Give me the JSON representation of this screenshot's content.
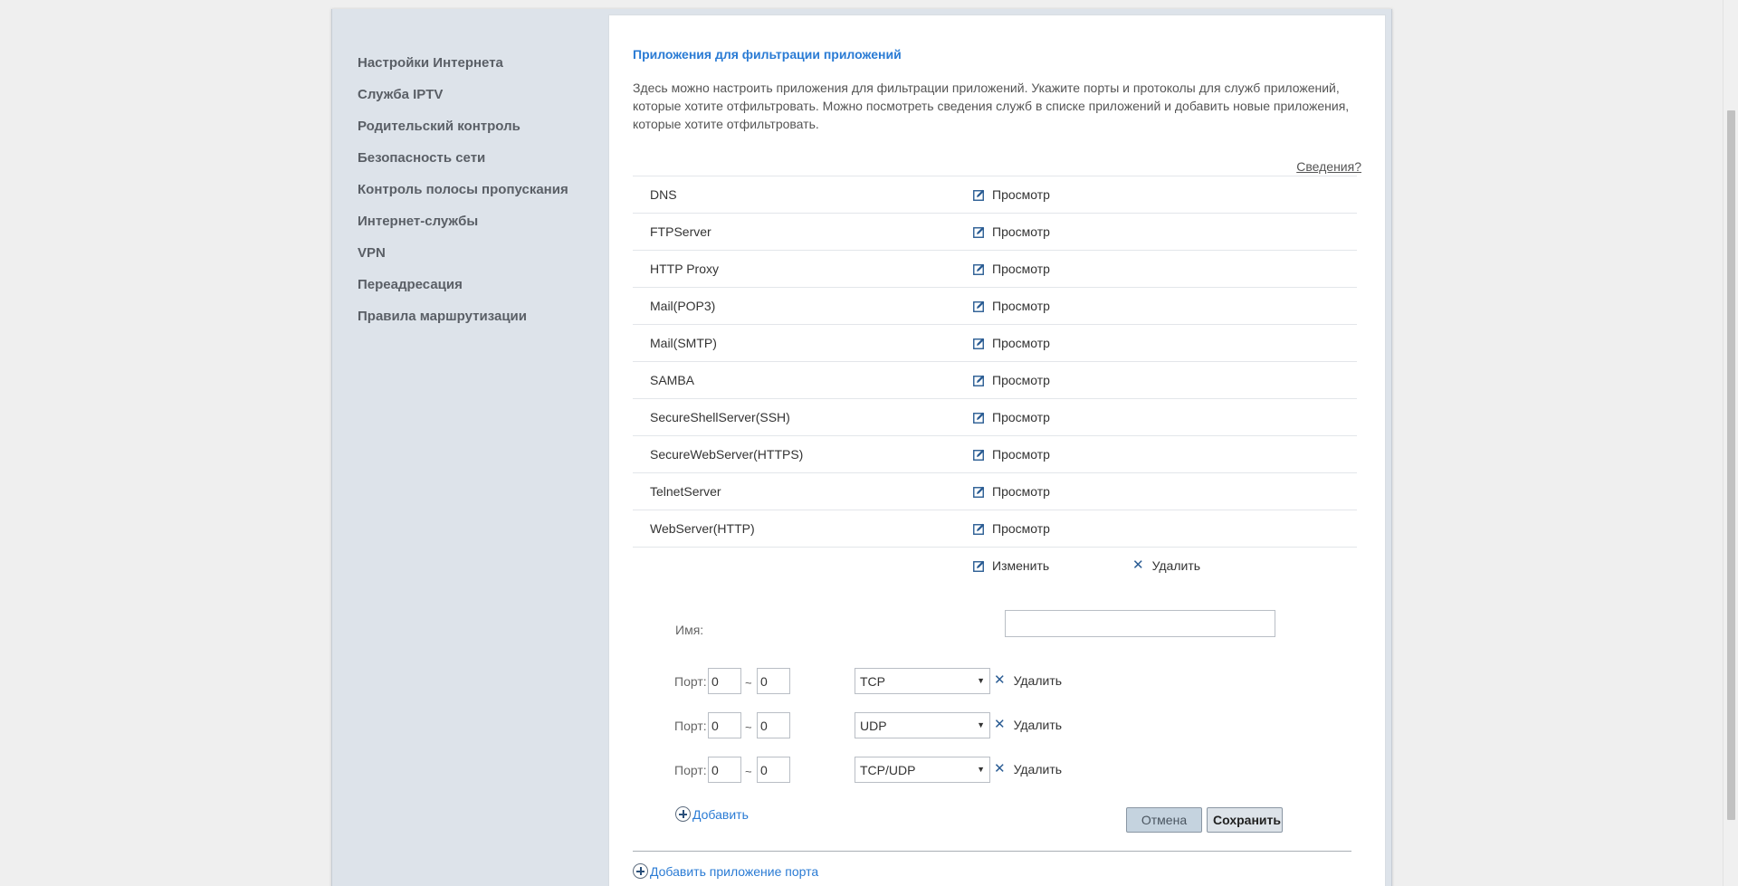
{
  "sidebar": {
    "items": [
      {
        "label": "Настройки Интернета"
      },
      {
        "label": "Служба IPTV"
      },
      {
        "label": "Родительский контроль"
      },
      {
        "label": "Безопасность сети"
      },
      {
        "label": "Контроль полосы пропускания"
      },
      {
        "label": "Интернет-службы"
      },
      {
        "label": "VPN"
      },
      {
        "label": "Переадресация"
      },
      {
        "label": "Правила маршрутизации"
      }
    ]
  },
  "main": {
    "title": "Приложения для фильтрации приложений",
    "description": "Здесь можно настроить приложения для фильтрации приложений. Укажите порты и протоколы для служб приложений, которые хотите отфильтровать. Можно посмотреть сведения служб в списке приложений и добавить новые приложения, которые хотите отфильтровать.",
    "details_link": "Сведения?",
    "view_label": "Просмотр",
    "apps": [
      {
        "name": "DNS"
      },
      {
        "name": "FTPServer"
      },
      {
        "name": "HTTP Proxy"
      },
      {
        "name": "Mail(POP3)"
      },
      {
        "name": "Mail(SMTP)"
      },
      {
        "name": "SAMBA"
      },
      {
        "name": "SecureShellServer(SSH)"
      },
      {
        "name": "SecureWebServer(HTTPS)"
      },
      {
        "name": "TelnetServer"
      },
      {
        "name": "WebServer(HTTP)"
      }
    ],
    "edit_label": "Изменить",
    "delete_label": "Удалить"
  },
  "form": {
    "name_label": "Имя:",
    "name_value": "",
    "port_label": "Порт:",
    "tilde": "~",
    "port_rows": [
      {
        "from": "0",
        "to": "0",
        "protocol": "TCP",
        "delete_label": "Удалить"
      },
      {
        "from": "0",
        "to": "0",
        "protocol": "UDP",
        "delete_label": "Удалить"
      },
      {
        "from": "0",
        "to": "0",
        "protocol": "TCP/UDP",
        "delete_label": "Удалить"
      }
    ],
    "add_label": "Добавить",
    "cancel_label": "Отмена",
    "save_label": "Сохранить",
    "add_port_app_label": "Добавить приложение порта"
  }
}
